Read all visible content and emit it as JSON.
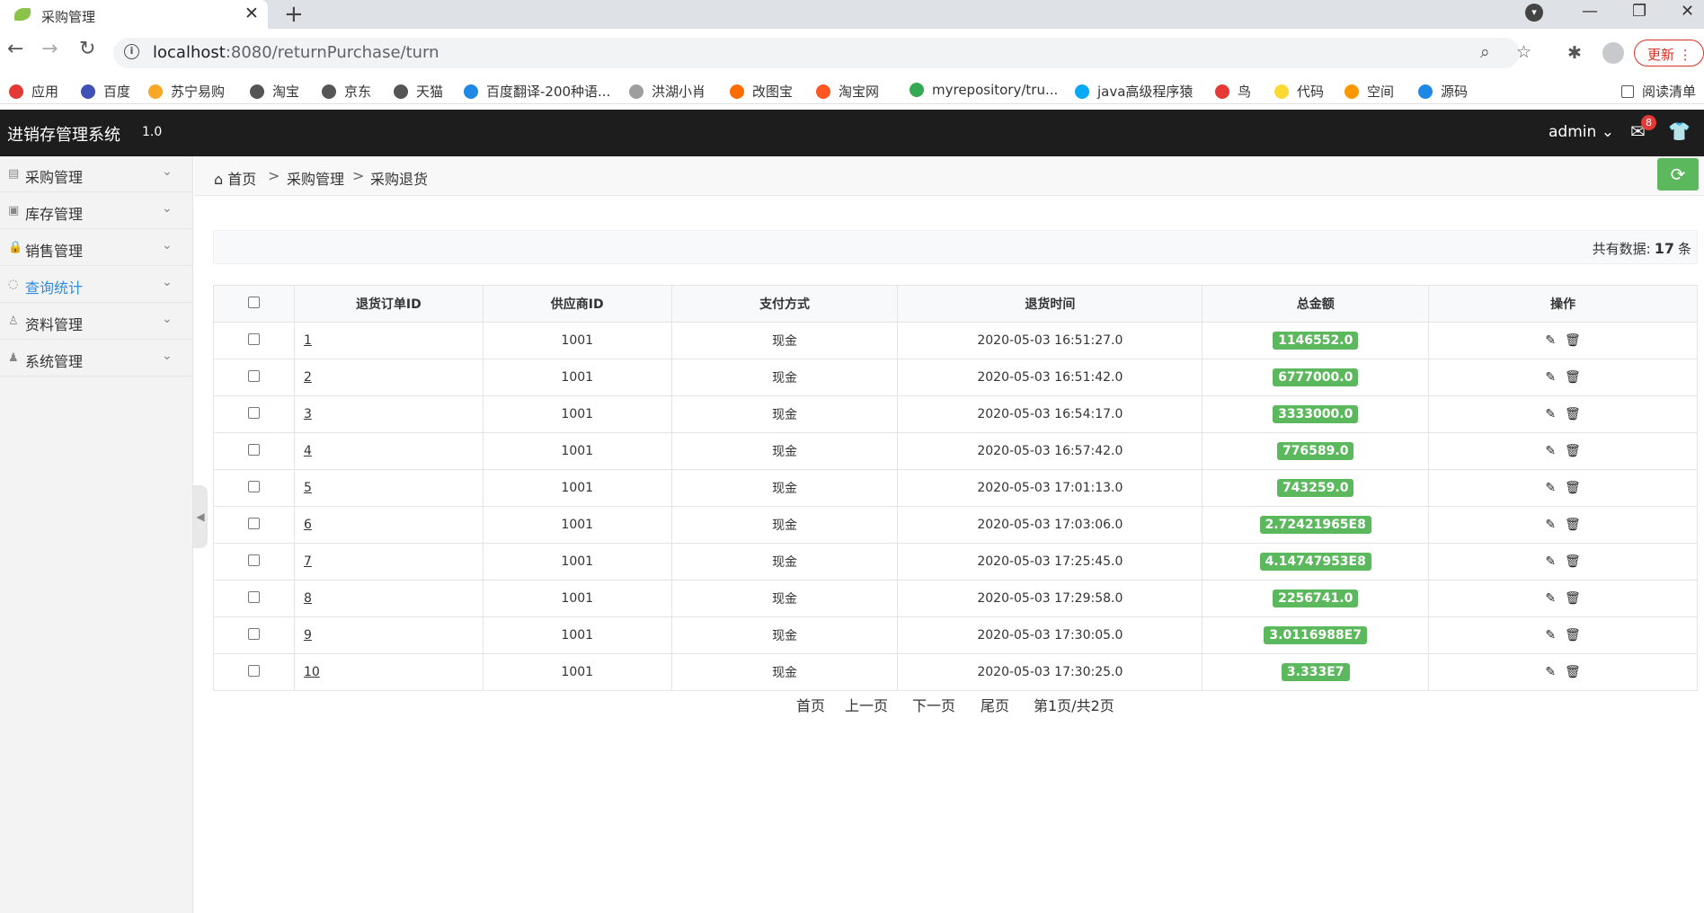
{
  "browser": {
    "tab_title": "采购管理",
    "url_host": "localhost",
    "url_rest": ":8080/returnPurchase/turn",
    "update_label": "更新",
    "bookmarks": [
      {
        "label": "应用",
        "color": "#e53935"
      },
      {
        "label": "百度",
        "color": "#3f51b5"
      },
      {
        "label": "苏宁易购",
        "color": "#f9a825"
      },
      {
        "label": "淘宝",
        "color": "#555555"
      },
      {
        "label": "京东",
        "color": "#555555"
      },
      {
        "label": "天猫",
        "color": "#555555"
      },
      {
        "label": "百度翻译-200种语...",
        "color": "#1e88e5"
      },
      {
        "label": "洪湖小肖",
        "color": "#9e9e9e"
      },
      {
        "label": "改图宝",
        "color": "#ff6d00"
      },
      {
        "label": "淘宝网",
        "color": "#ff5722"
      },
      {
        "label": "myrepository/tru...",
        "color": "#34a853"
      },
      {
        "label": "java高级程序猿",
        "color": "#03a9f4"
      },
      {
        "label": "鸟",
        "color": "#e53935"
      },
      {
        "label": "代码",
        "color": "#fdd835"
      },
      {
        "label": "空间",
        "color": "#ff9800"
      },
      {
        "label": "源码",
        "color": "#1e88e5"
      }
    ],
    "reading_list": "阅读清单"
  },
  "app": {
    "brand": "进销存管理系统",
    "version": "1.0",
    "user": "admin",
    "mail_badge": "8"
  },
  "sidebar": {
    "items": [
      {
        "label": "采购管理",
        "icon": "list-icon",
        "active": false
      },
      {
        "label": "库存管理",
        "icon": "image-icon",
        "active": false
      },
      {
        "label": "销售管理",
        "icon": "bag-icon",
        "active": false
      },
      {
        "label": "查询统计",
        "icon": "chat-icon",
        "active": true
      },
      {
        "label": "资料管理",
        "icon": "person-icon",
        "active": false
      },
      {
        "label": "系统管理",
        "icon": "user-icon",
        "active": false
      }
    ]
  },
  "breadcrumb": {
    "home": "首页",
    "sep": ">",
    "level1": "采购管理",
    "level2": "采购退货"
  },
  "summary": {
    "prefix": "共有数据:",
    "count": "17",
    "suffix": "条"
  },
  "table": {
    "headers": [
      "退货订单ID",
      "供应商ID",
      "支付方式",
      "退货时间",
      "总金额",
      "操作"
    ],
    "rows": [
      {
        "id": "1",
        "supplier": "1001",
        "pay": "现金",
        "time": "2020-05-03 16:51:27.0",
        "amount": "1146552.0"
      },
      {
        "id": "2",
        "supplier": "1001",
        "pay": "现金",
        "time": "2020-05-03 16:51:42.0",
        "amount": "6777000.0"
      },
      {
        "id": "3",
        "supplier": "1001",
        "pay": "现金",
        "time": "2020-05-03 16:54:17.0",
        "amount": "3333000.0"
      },
      {
        "id": "4",
        "supplier": "1001",
        "pay": "现金",
        "time": "2020-05-03 16:57:42.0",
        "amount": "776589.0"
      },
      {
        "id": "5",
        "supplier": "1001",
        "pay": "现金",
        "time": "2020-05-03 17:01:13.0",
        "amount": "743259.0"
      },
      {
        "id": "6",
        "supplier": "1001",
        "pay": "现金",
        "time": "2020-05-03 17:03:06.0",
        "amount": "2.72421965E8"
      },
      {
        "id": "7",
        "supplier": "1001",
        "pay": "现金",
        "time": "2020-05-03 17:25:45.0",
        "amount": "4.14747953E8"
      },
      {
        "id": "8",
        "supplier": "1001",
        "pay": "现金",
        "time": "2020-05-03 17:29:58.0",
        "amount": "2256741.0"
      },
      {
        "id": "9",
        "supplier": "1001",
        "pay": "现金",
        "time": "2020-05-03 17:30:05.0",
        "amount": "3.0116988E7"
      },
      {
        "id": "10",
        "supplier": "1001",
        "pay": "现金",
        "time": "2020-05-03 17:30:25.0",
        "amount": "3.333E7"
      }
    ]
  },
  "pager": {
    "first": "首页",
    "prev": "上一页",
    "next": "下一页",
    "last": "尾页",
    "status": "第1页/共2页"
  },
  "colors": {
    "header_bg": "#1d1d1d",
    "accent_green": "#5cb85c",
    "active_link": "#2e8be0"
  }
}
